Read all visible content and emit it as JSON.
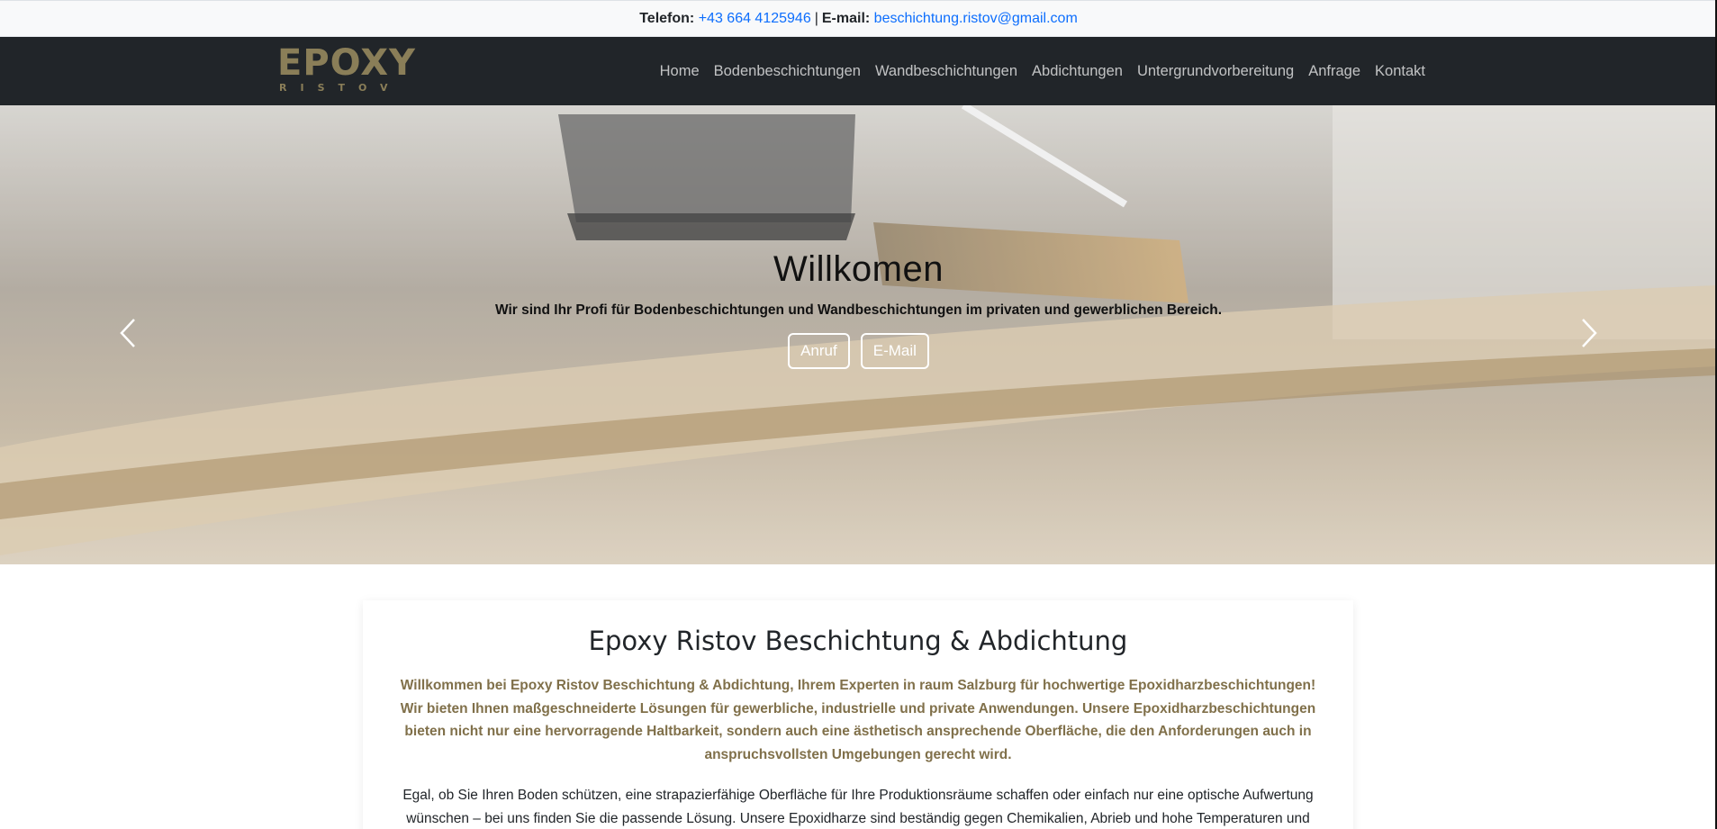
{
  "topbar": {
    "phone_label": "Telefon:",
    "phone_value": "+43 664 4125946",
    "separator": "|",
    "email_label": "E-mail:",
    "email_value": "beschichtung.ristov@gmail.com"
  },
  "brand": {
    "word": "EPOXY",
    "sub": "RISTOV",
    "color": "#8a7e58"
  },
  "nav": {
    "items": [
      {
        "label": "Home"
      },
      {
        "label": "Bodenbeschichtungen"
      },
      {
        "label": "Wandbeschichtungen"
      },
      {
        "label": "Abdichtungen"
      },
      {
        "label": "Untergrundvorbereitung"
      },
      {
        "label": "Anfrage"
      },
      {
        "label": "Kontakt"
      }
    ]
  },
  "hero": {
    "title": "Willkomen",
    "subtitle": "Wir sind Ihr Profi für Bodenbeschichtungen und Wandbeschichtungen im privaten und gewerblichen Bereich.",
    "buttons": {
      "call": "Anruf",
      "email": "E-Mail"
    },
    "prev_icon": "chevron-left-icon",
    "next_icon": "chevron-right-icon"
  },
  "intro": {
    "title": "Epoxy Ristov Beschichtung & Abdichtung",
    "lead_lines": [
      "Willkommen bei Epoxy Ristov Beschichtung & Abdichtung, Ihrem Experten in raum Salzburg für hochwertige Epoxidharzbeschichtungen!",
      "Wir bieten Ihnen maßgeschneiderte Lösungen für gewerbliche, industrielle und private Anwendungen. Unsere Epoxidharzbeschichtungen",
      "bieten nicht nur eine hervorragende Haltbarkeit, sondern auch eine ästhetisch ansprechende Oberfläche, die den Anforderungen auch in",
      "anspruchsvollsten Umgebungen gerecht wird."
    ],
    "body_lines": [
      "Egal, ob Sie Ihren Boden schützen, eine strapazierfähige Oberfläche für Ihre Produktionsräume schaffen oder einfach nur eine optische Aufwertung",
      "wünschen – bei uns finden Sie die passende Lösung. Unsere Epoxidharze sind beständig gegen Chemikalien, Abrieb und hohe Temperaturen und"
    ],
    "accent_color": "#80704a"
  }
}
